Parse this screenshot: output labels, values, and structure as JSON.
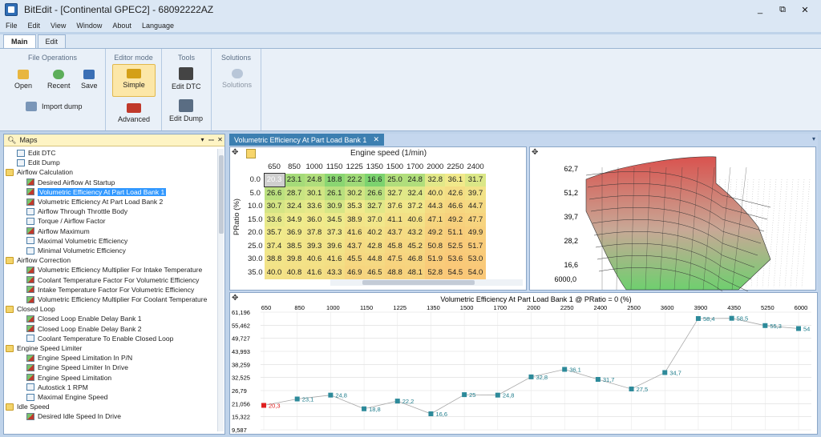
{
  "window": {
    "title": "BitEdit - [Continental GPEC2] - 68092222AZ",
    "buttons": [
      "_",
      "⧉",
      "✕"
    ]
  },
  "menu": [
    "File",
    "Edit",
    "View",
    "Window",
    "About",
    "Language"
  ],
  "ribbon_tabs": [
    "Main",
    "Edit"
  ],
  "ribbon": {
    "groups": [
      {
        "title": "File Operations",
        "buttons": [
          "Open",
          "Recent",
          "Save",
          "Import dump"
        ]
      },
      {
        "title": "Editor mode",
        "buttons": [
          "Simple",
          "Advanced"
        ]
      },
      {
        "title": "Tools",
        "buttons": [
          "Edit DTC",
          "Edit Dump"
        ]
      },
      {
        "title": "Solutions",
        "buttons": [
          "Solutions"
        ]
      }
    ]
  },
  "maps_panel": {
    "title": "Maps",
    "controls": [
      "▾",
      "ꟷ",
      "✕"
    ],
    "nodes": [
      {
        "label": "Edit DTC",
        "level": 1,
        "icon": "dtc-icon"
      },
      {
        "label": "Edit Dump",
        "level": 1,
        "icon": "dtc-icon"
      },
      {
        "label": "Airflow Calculation",
        "level": 0,
        "icon": "folder-icon"
      },
      {
        "label": "Desired Airflow At Startup",
        "level": 2,
        "icon": "map3d-icon"
      },
      {
        "label": "Volumetric Efficiency At Part Load Bank 1",
        "level": 2,
        "icon": "map3d-icon",
        "selected": true
      },
      {
        "label": "Volumetric Efficiency At Part Load Bank 2",
        "level": 2,
        "icon": "map3d-icon"
      },
      {
        "label": "Airflow Through Throttle Body",
        "level": 2,
        "icon": "table-icon"
      },
      {
        "label": "Torque / Airflow Factor",
        "level": 2,
        "icon": "table-icon"
      },
      {
        "label": "Airflow Maximum",
        "level": 2,
        "icon": "map3d-icon"
      },
      {
        "label": "Maximal Volumetric Efficiency",
        "level": 2,
        "icon": "table-icon"
      },
      {
        "label": "Minimal Volumetric Efficiency",
        "level": 2,
        "icon": "table-icon"
      },
      {
        "label": "Airflow Correction",
        "level": 0,
        "icon": "folder-icon"
      },
      {
        "label": "Volumetric Efficiency Multiplier For Intake Temperature",
        "level": 2,
        "icon": "map3d-icon"
      },
      {
        "label": "Coolant Temperature Factor For Volumetric Efficiency",
        "level": 2,
        "icon": "map3d-icon"
      },
      {
        "label": "Intake Temperature Factor For Volumetric Efficiency",
        "level": 2,
        "icon": "map3d-icon"
      },
      {
        "label": "Volumetric Efficiency Multiplier For Coolant Temperature",
        "level": 2,
        "icon": "map3d-icon"
      },
      {
        "label": "Closed Loop",
        "level": 0,
        "icon": "folder-icon"
      },
      {
        "label": "Closed Loop Enable Delay Bank 1",
        "level": 2,
        "icon": "map3d-icon"
      },
      {
        "label": "Closed Loop Enable Delay Bank 2",
        "level": 2,
        "icon": "map3d-icon"
      },
      {
        "label": "Coolant Temperature To Enable Closed Loop",
        "level": 2,
        "icon": "table-icon"
      },
      {
        "label": "Engine Speed Limiter",
        "level": 0,
        "icon": "folder-icon"
      },
      {
        "label": "Engine Speed Limitation In P/N",
        "level": 2,
        "icon": "map3d-icon"
      },
      {
        "label": "Engine Speed Limiter In Drive",
        "level": 2,
        "icon": "map3d-icon"
      },
      {
        "label": "Engine Speed Limitation",
        "level": 2,
        "icon": "map3d-icon"
      },
      {
        "label": "Autostick 1 RPM",
        "level": 2,
        "icon": "table-icon"
      },
      {
        "label": "Maximal Engine Speed",
        "level": 2,
        "icon": "table-icon"
      },
      {
        "label": "Idle Speed",
        "level": 0,
        "icon": "folder-icon"
      },
      {
        "label": "Desired Idle Speed In Drive",
        "level": 2,
        "icon": "map3d-icon"
      }
    ]
  },
  "document": {
    "tab": "Volumetric Efficiency At Part Load Bank 1",
    "close": "✕",
    "menu": "▾"
  },
  "table": {
    "col_title": "Engine speed (1/min)",
    "row_title": "PRatio (%)",
    "cols": [
      "650",
      "850",
      "1000",
      "1150",
      "1225",
      "1350",
      "1500",
      "1700",
      "2000",
      "2250",
      "2400"
    ],
    "rows": [
      {
        "r": "0.0",
        "v": [
          "20.3",
          "23.1",
          "24.8",
          "18.8",
          "22.2",
          "16.6",
          "25.0",
          "24.8",
          "32.8",
          "36.1",
          "31.7"
        ]
      },
      {
        "r": "5.0",
        "v": [
          "26.6",
          "28.7",
          "30.1",
          "26.1",
          "30.2",
          "26.6",
          "32.7",
          "32.4",
          "40.0",
          "42.6",
          "39.7"
        ]
      },
      {
        "r": "10.0",
        "v": [
          "30.7",
          "32.4",
          "33.6",
          "30.9",
          "35.3",
          "32.7",
          "37.6",
          "37.2",
          "44.3",
          "46.6",
          "44.7"
        ]
      },
      {
        "r": "15.0",
        "v": [
          "33.6",
          "34.9",
          "36.0",
          "34.5",
          "38.9",
          "37.0",
          "41.1",
          "40.6",
          "47.1",
          "49.2",
          "47.7"
        ]
      },
      {
        "r": "20.0",
        "v": [
          "35.7",
          "36.9",
          "37.8",
          "37.3",
          "41.6",
          "40.2",
          "43.7",
          "43.2",
          "49.2",
          "51.1",
          "49.9"
        ]
      },
      {
        "r": "25.0",
        "v": [
          "37.4",
          "38.5",
          "39.3",
          "39.6",
          "43.7",
          "42.8",
          "45.8",
          "45.2",
          "50.8",
          "52.5",
          "51.7"
        ]
      },
      {
        "r": "30.0",
        "v": [
          "38.8",
          "39.8",
          "40.6",
          "41.6",
          "45.5",
          "44.8",
          "47.5",
          "46.8",
          "51.9",
          "53.6",
          "53.0"
        ]
      },
      {
        "r": "35.0",
        "v": [
          "40.0",
          "40.8",
          "41.6",
          "43.3",
          "46.9",
          "46.5",
          "48.8",
          "48.1",
          "52.8",
          "54.5",
          "54.0"
        ]
      }
    ]
  },
  "chart3d": {
    "z_ticks": [
      "62,7",
      "51,2",
      "39,7",
      "28,2",
      "16,6"
    ],
    "x_tick": "6000,0"
  },
  "line_chart": {
    "title": "Volumetric Efficiency At Part Load Bank 1 @ PRatio = 0 (%)",
    "y_ticks": [
      "61,196",
      "55,462",
      "49,727",
      "43,993",
      "38,259",
      "32,525",
      "26,79",
      "21,056",
      "15,322",
      "9,587"
    ]
  },
  "chart_data": {
    "type": "line",
    "title": "Volumetric Efficiency At Part Load Bank 1 @ PRatio = 0 (%)",
    "categories": [
      "650",
      "850",
      "1000",
      "1150",
      "1225",
      "1350",
      "1500",
      "1700",
      "2000",
      "2250",
      "2400",
      "2500",
      "3600",
      "3900",
      "4350",
      "5250",
      "6000"
    ],
    "values": [
      20.3,
      23.1,
      24.8,
      18.8,
      22.2,
      16.6,
      25,
      24.8,
      32.8,
      36.1,
      31.7,
      27.5,
      34.7,
      58.4,
      58.5,
      55.3,
      54
    ],
    "labels": [
      "20,3",
      "23,1",
      "24,8",
      "18,8",
      "22,2",
      "16,6",
      "25",
      "24,8",
      "32,8",
      "36,1",
      "31,7",
      "27,5",
      "34,7",
      "58,4",
      "58,5",
      "55,3",
      "54"
    ],
    "ylim": [
      9.587,
      61.196
    ],
    "grid": true,
    "colors": {
      "marker": "#2d8a9a",
      "first": "#e02020",
      "line": "#a8a8a8",
      "text": "#1f7d8c"
    }
  }
}
